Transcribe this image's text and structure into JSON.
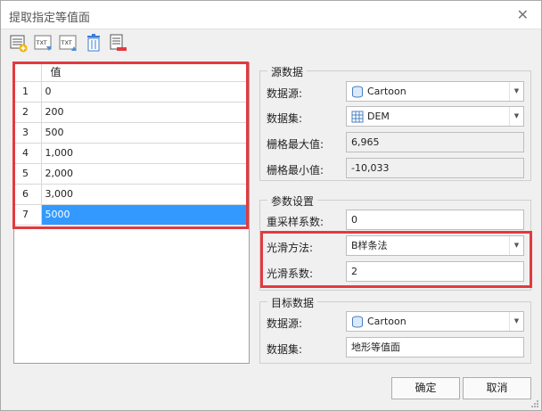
{
  "window": {
    "title": "提取指定等值面",
    "close_glyph": "✕"
  },
  "toolbar": {
    "icons": [
      "add-row-icon",
      "import-txt-icon",
      "export-txt-icon",
      "delete-icon",
      "clear-icon"
    ],
    "txt_label": "TXT"
  },
  "grid": {
    "header": "值",
    "rows": [
      {
        "n": "1",
        "value": "0"
      },
      {
        "n": "2",
        "value": "200"
      },
      {
        "n": "3",
        "value": "500"
      },
      {
        "n": "4",
        "value": "1,000"
      },
      {
        "n": "5",
        "value": "2,000"
      },
      {
        "n": "6",
        "value": "3,000"
      },
      {
        "n": "7",
        "value": "5000"
      }
    ],
    "selected_row": 7
  },
  "source": {
    "title": "源数据",
    "datasource_label": "数据源:",
    "datasource_value": "Cartoon",
    "dataset_label": "数据集:",
    "dataset_value": "DEM",
    "max_label": "栅格最大值:",
    "max_value": "6,965",
    "min_label": "栅格最小值:",
    "min_value": "-10,033"
  },
  "params": {
    "title": "参数设置",
    "resample_label": "重采样系数:",
    "resample_value": "0",
    "smooth_method_label": "光滑方法:",
    "smooth_method_value": "B样条法",
    "smoothness_label": "光滑系数:",
    "smoothness_value": "2"
  },
  "target": {
    "title": "目标数据",
    "datasource_label": "数据源:",
    "datasource_value": "Cartoon",
    "dataset_label": "数据集:",
    "dataset_value": "地形等值面"
  },
  "buttons": {
    "ok": "确定",
    "cancel": "取消"
  },
  "colors": {
    "highlight": "#e23a3f",
    "selection": "#3399ff"
  }
}
